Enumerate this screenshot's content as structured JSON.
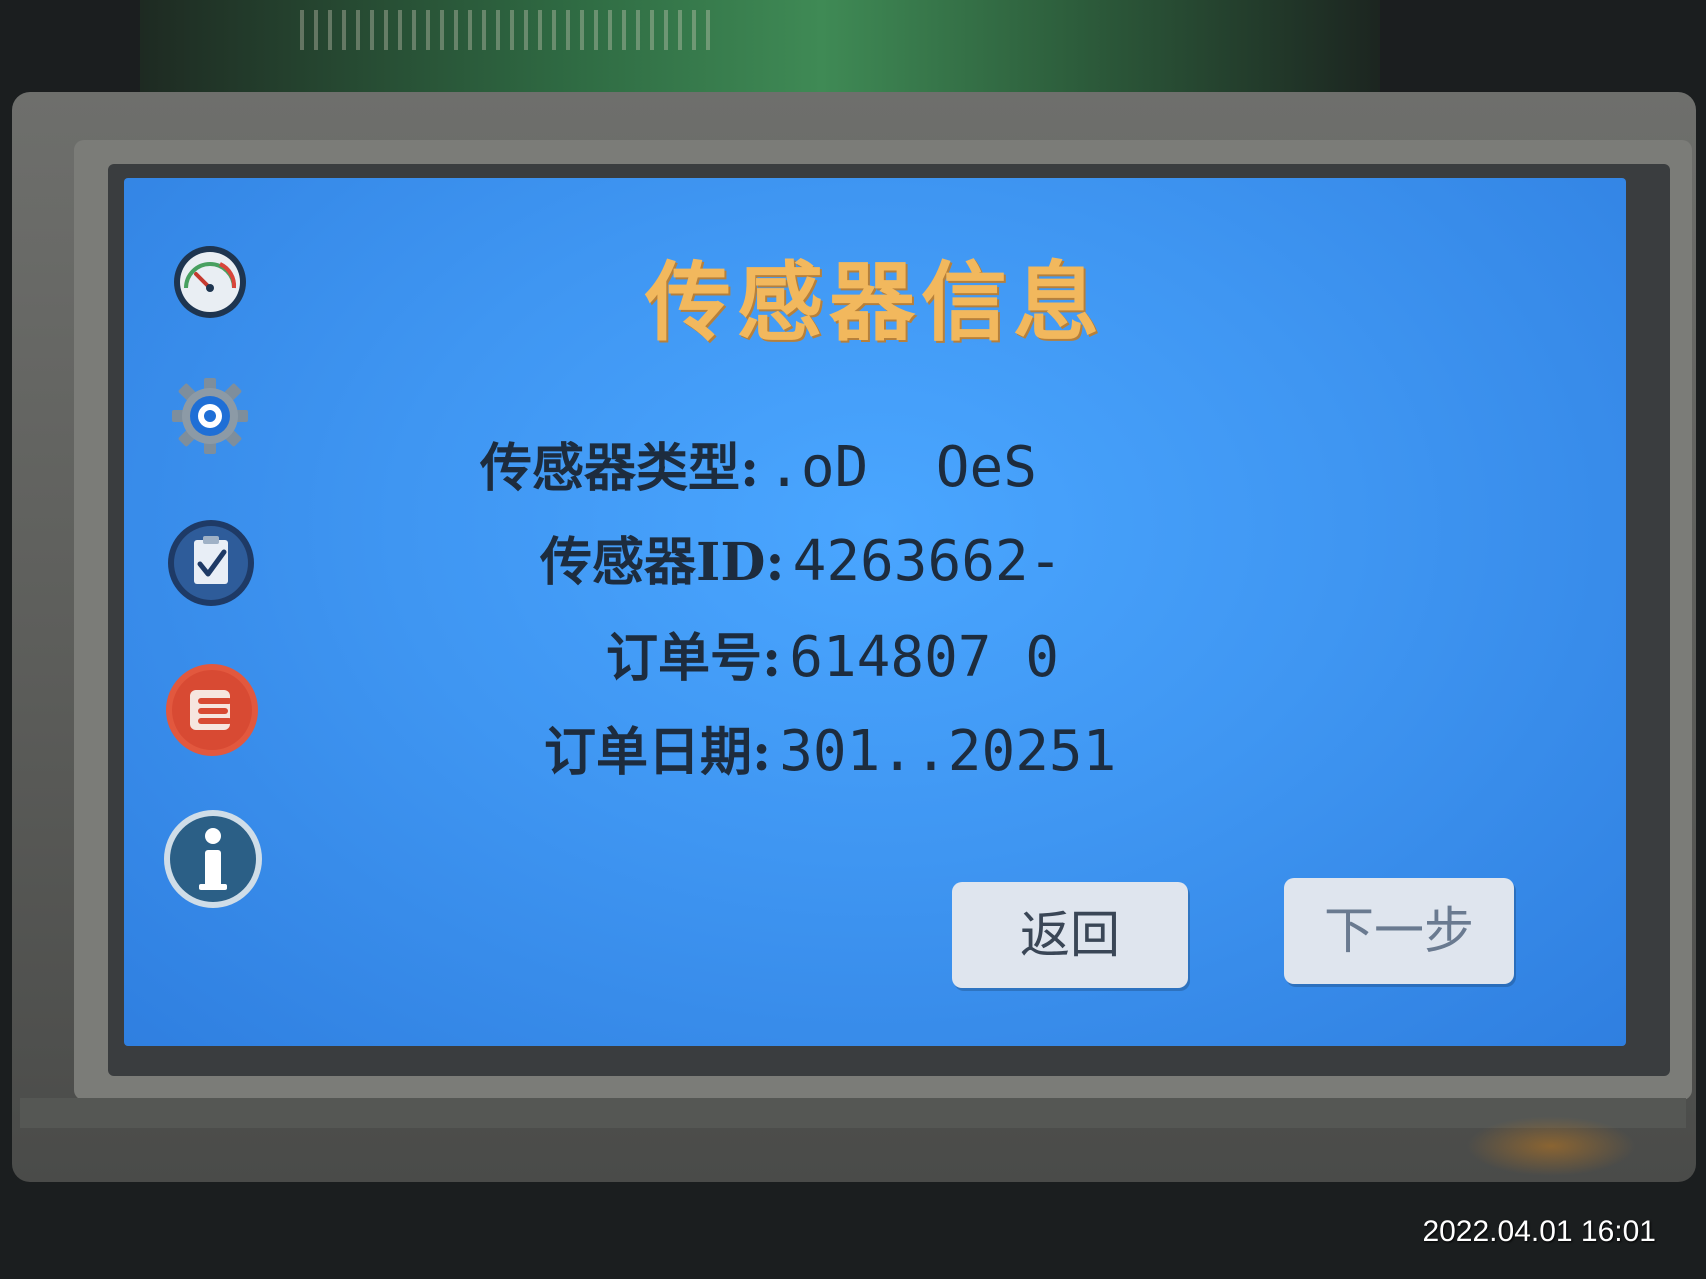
{
  "screen": {
    "title": "传感器信息",
    "fields": {
      "type": {
        "label": "传感器类型:",
        "value": ".oD  OeS"
      },
      "id": {
        "label": "传感器ID:",
        "value": "4263662-"
      },
      "order": {
        "label": "订单号:",
        "value": "614807 0"
      },
      "date": {
        "label": "订单日期:",
        "value": "301..20251"
      }
    },
    "buttons": {
      "back": "返回",
      "next": "下一步"
    },
    "sidebar_icons": [
      "gauge-icon",
      "gear-icon",
      "clipboard-check-icon",
      "list-icon",
      "info-icon"
    ]
  },
  "photo_timestamp": "2022.04.01 16:01",
  "colors": {
    "screen_bg": "#3f96f2",
    "title": "#f2b85d",
    "text": "#1d2c3e",
    "button_bg": "#dfe5ee"
  }
}
